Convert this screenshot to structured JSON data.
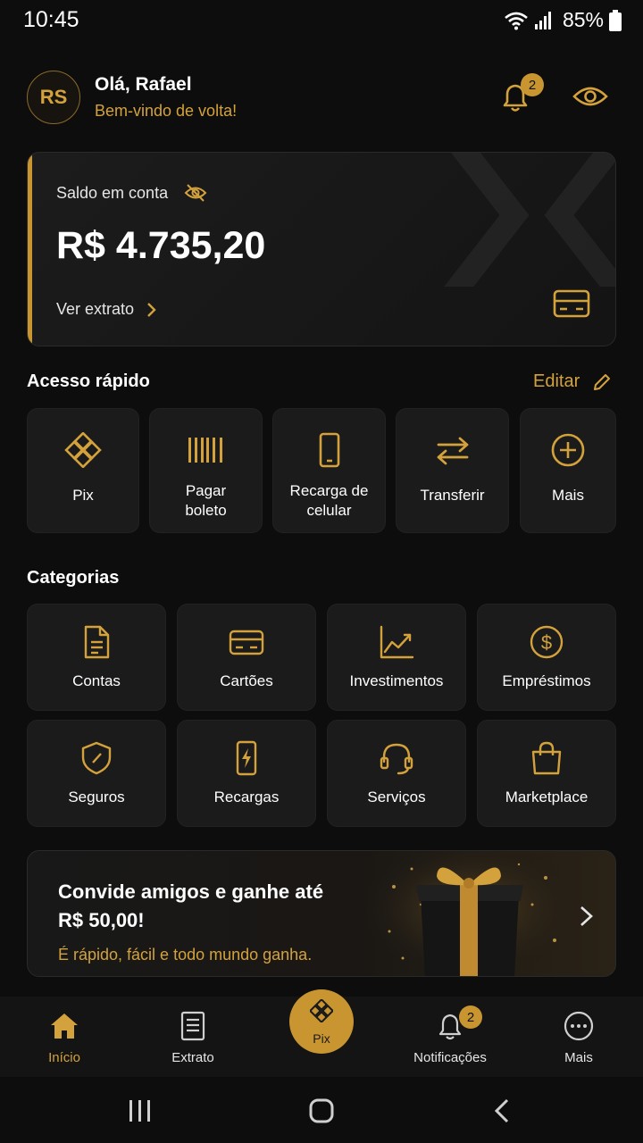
{
  "status": {
    "time": "10:45",
    "battery": "85%"
  },
  "header": {
    "avatar_initials": "RS",
    "greeting": "Olá, Rafael",
    "welcome": "Bem-vindo de volta!",
    "notification_count": "2"
  },
  "balance": {
    "label": "Saldo em conta",
    "amount": "R$ 4.735,20",
    "statement_link": "Ver extrato"
  },
  "quick_access": {
    "title": "Acesso rápido",
    "edit_label": "Editar",
    "items": [
      {
        "line1": "Pix",
        "line2": "",
        "icon": "pix-icon"
      },
      {
        "line1": "Pagar",
        "line2": "boleto",
        "icon": "barcode-icon"
      },
      {
        "line1": "Recarga de",
        "line2": "celular",
        "icon": "phone-icon"
      },
      {
        "line1": "Transferir",
        "line2": "",
        "icon": "transfer-icon"
      },
      {
        "line1": "Mais",
        "line2": "",
        "icon": "plus-circle-icon"
      }
    ]
  },
  "categories": {
    "title": "Categorias",
    "items": [
      {
        "label": "Contas",
        "icon": "document-icon"
      },
      {
        "label": "Cartões",
        "icon": "card-icon"
      },
      {
        "label": "Investimentos",
        "icon": "chart-icon"
      },
      {
        "label": "Empréstimos",
        "icon": "dollar-icon"
      },
      {
        "label": "Seguros",
        "icon": "shield-icon"
      },
      {
        "label": "Recargas",
        "icon": "phone-bolt-icon"
      },
      {
        "label": "Serviços",
        "icon": "headset-icon"
      },
      {
        "label": "Marketplace",
        "icon": "bag-icon"
      }
    ]
  },
  "referral": {
    "title": "Convide amigos e ganhe até R$ 50,00!",
    "subtitle": "É rápido, fácil e todo mundo ganha."
  },
  "bottom_nav": {
    "items": [
      {
        "label": "Início",
        "icon": "home-icon",
        "active": true
      },
      {
        "label": "Extrato",
        "icon": "statement-icon",
        "active": false
      },
      {
        "label": "Pix",
        "icon": "pix-icon",
        "active": false
      },
      {
        "label": "Notificações",
        "icon": "bell-icon",
        "active": false
      },
      {
        "label": "Mais",
        "icon": "more-icon",
        "active": false
      }
    ],
    "notification_count": "2"
  },
  "colors": {
    "accent": "#d4a23c",
    "background": "#0d0d0d",
    "tile": "#1b1b1b"
  }
}
